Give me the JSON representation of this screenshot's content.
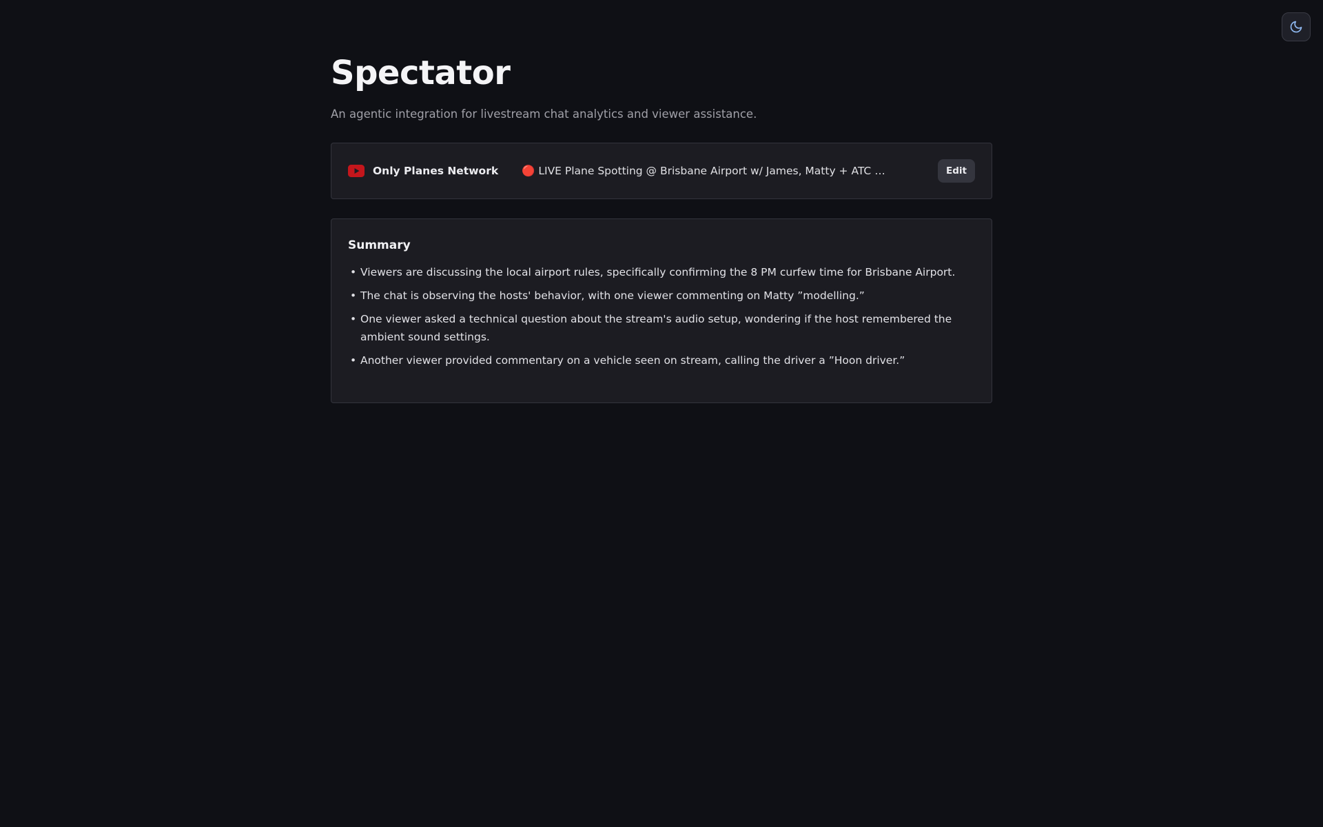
{
  "app": {
    "title": "Spectator",
    "subtitle": "An agentic integration for livestream chat analytics and viewer assistance."
  },
  "theme_toggle": {
    "icon": "moon-icon",
    "accent": "#8fb8f0"
  },
  "stream": {
    "platform_icon": "youtube-icon",
    "platform_color": "#e02424",
    "channel_name": "Only Planes Network",
    "title": "🔴 LIVE Plane Spotting @ Brisbane Airport w/ James, Matty + ATC ✈️ | Brisbane Airport Live Stream",
    "edit_label": "Edit"
  },
  "summary": {
    "heading": "Summary",
    "items": [
      "Viewers are discussing the local airport rules, specifically confirming the 8 PM curfew time for Brisbane Airport.",
      "The chat is observing the hosts' behavior, with one viewer commenting on Matty ”modelling.”",
      "One viewer asked a technical question about the stream's audio setup, wondering if the host remembered the ambient sound settings.",
      "Another viewer provided commentary on a vehicle seen on stream, calling the driver a ”Hoon driver.”"
    ]
  }
}
